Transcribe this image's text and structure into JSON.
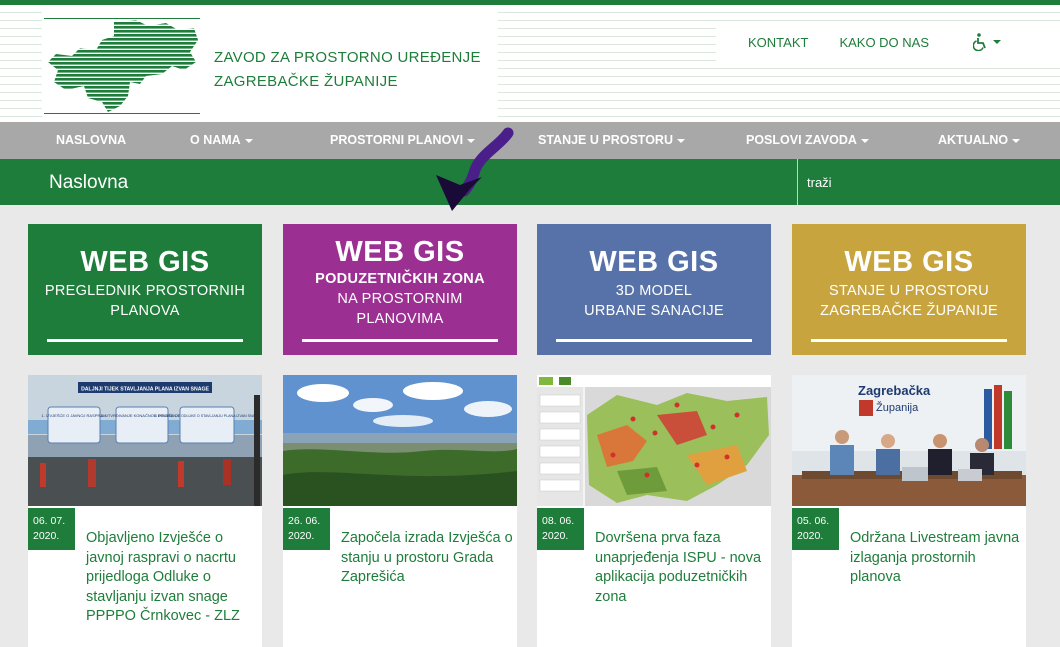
{
  "header": {
    "org_line1": "ZAVOD ZA PROSTORNO UREĐENJE",
    "org_line2": "ZAGREBAČKE ŽUPANIJE",
    "links": [
      "KONTAKT",
      "KAKO DO NAS"
    ],
    "accessibility_icon": "wheelchair-icon"
  },
  "nav": {
    "items": [
      "NASLOVNA",
      "O NAMA",
      "PROSTORNI PLANOVI",
      "STANJE U PROSTORU",
      "POSLOVI ZAVODA",
      "AKTUALNO"
    ]
  },
  "page": {
    "title": "Naslovna",
    "search_placeholder": "traži"
  },
  "tiles": [
    {
      "big": "WEB GIS",
      "sub1": "PREGLEDNIK PROSTORNIH",
      "sub2": "PLANOVA",
      "color": "#1e7d3a"
    },
    {
      "big": "WEB GIS",
      "sub1": "PODUZETNIČKIH ZONA",
      "sub2": "NA PROSTORNIM",
      "sub3": "PLANOVIMA",
      "color": "#9b2f92"
    },
    {
      "big": "WEB GIS",
      "sub1": "3D MODEL",
      "sub2": "URBANE SANACIJE",
      "color": "#5672a8"
    },
    {
      "big": "WEB GIS",
      "sub1": "STANJE U PROSTORU",
      "sub2": "ZAGREBAČKE ŽUPANIJE",
      "color": "#c8a43e"
    }
  ],
  "news": [
    {
      "date1": "06. 07.",
      "date2": "2020.",
      "title": "Objavljeno Izvješće o javnoj raspravi o nacrtu prijedloga Odluke o stavljanju izvan snage PPPPO Črnkovec - ZLZ",
      "img": {
        "heading": "DALJNJI TIJEK STAVLJANJA PLANA IZVAN SNAGE",
        "step1": "1. IZVJEŠĆE O JAVNOJ RASPRAVI",
        "step2": "2. UTVRĐIVANJE KONAČNOG PRIJEDLOGA",
        "step3": "3. DONOŠENJE ODLUKE O STAVLJANJU PLANA IZVAN SNAGE"
      }
    },
    {
      "date1": "26. 06.",
      "date2": "2020.",
      "title": "Započela izrada Izvješća o stanju u prostoru Grada Zaprešića"
    },
    {
      "date1": "08. 06.",
      "date2": "2020.",
      "title": "Dovršena prva faza unaprjeđenja ISPU - nova aplikacija poduzetničkih zona"
    },
    {
      "date1": "05. 06.",
      "date2": "2020.",
      "title": "Održana Livestream javna izlaganja prostornih planova",
      "img": {
        "wall1": "Zagrebačka",
        "wall2": "Županija"
      }
    }
  ],
  "colors": {
    "brand_green": "#1e7d3a",
    "nav_gray": "#a8a8a8",
    "arrow": "#4b1f8a"
  }
}
